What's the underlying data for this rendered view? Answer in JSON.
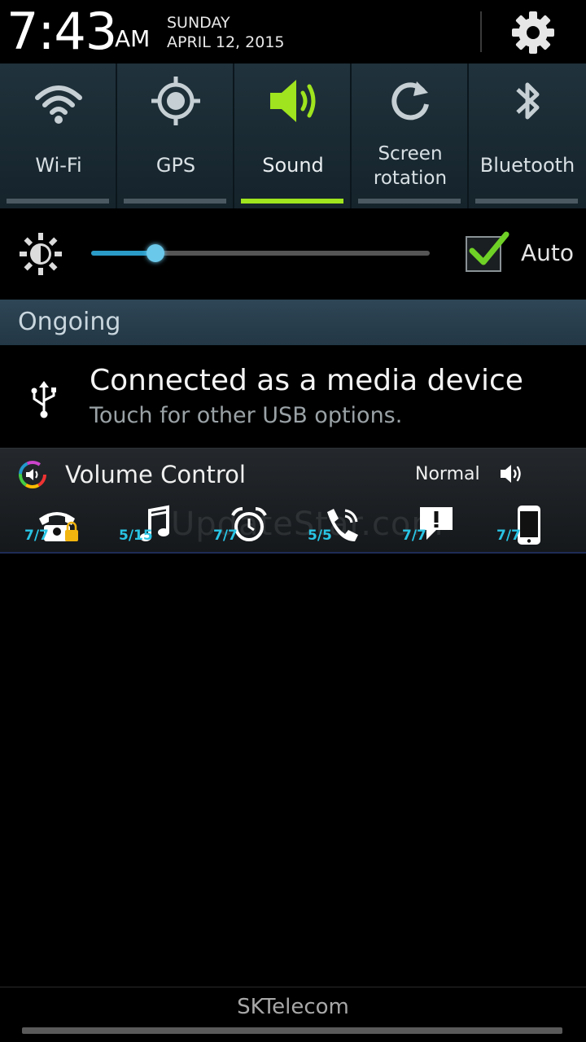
{
  "status": {
    "time": "7:43",
    "ampm": "AM",
    "day": "SUNDAY",
    "date": "APRIL 12, 2015"
  },
  "toggles": [
    {
      "label": "Wi-Fi",
      "icon": "wifi-icon",
      "active": false
    },
    {
      "label": "GPS",
      "icon": "gps-icon",
      "active": false
    },
    {
      "label": "Sound",
      "icon": "sound-icon",
      "active": true
    },
    {
      "label": "Screen rotation",
      "icon": "rotation-icon",
      "active": false
    },
    {
      "label": "Bluetooth",
      "icon": "bluetooth-icon",
      "active": false
    }
  ],
  "brightness": {
    "level": 0.19,
    "auto_label": "Auto",
    "auto_checked": true
  },
  "ongoing": {
    "label": "Ongoing",
    "usb_title": "Connected as a media device",
    "usb_sub": "Touch for other USB options."
  },
  "volume_control": {
    "title": "Volume Control",
    "mode": "Normal",
    "watermark": "UpdateStar.com",
    "items": [
      {
        "icon": "ringtone-locked-icon",
        "level": "7/7"
      },
      {
        "icon": "music-icon",
        "level": "5/15"
      },
      {
        "icon": "alarm-icon",
        "level": "7/7"
      },
      {
        "icon": "call-icon",
        "level": "5/5"
      },
      {
        "icon": "notification-icon",
        "level": "7/7"
      },
      {
        "icon": "system-icon",
        "level": "7/7"
      }
    ]
  },
  "footer": {
    "carrier": "SKTelecom"
  },
  "colors": {
    "accent_green": "#9fe41e",
    "slider_blue": "#2a9bc7",
    "volume_level_cyan": "#29c4e4"
  }
}
